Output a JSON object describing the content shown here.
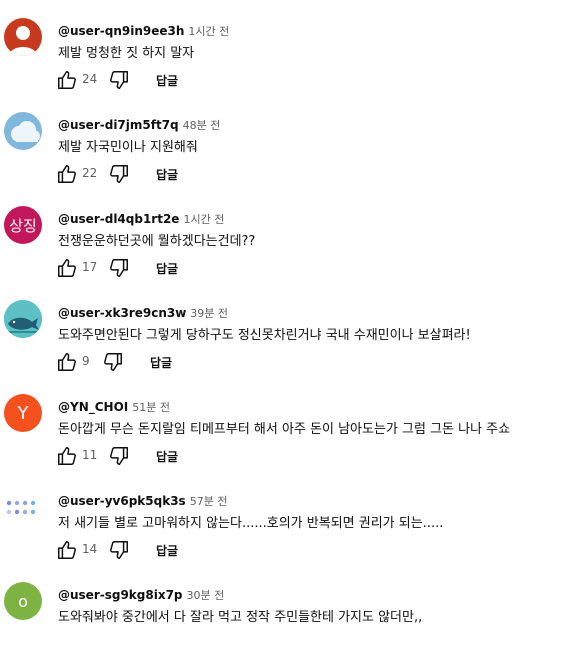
{
  "ui": {
    "reply_label": "답글"
  },
  "comments": [
    {
      "handle": "@user-qn9in9ee3h",
      "time": "1시간 전",
      "text": "제발 멍청한 짓 하지 말자",
      "likes": "24",
      "avatar": {
        "type": "person",
        "bg": "#c73a1e"
      }
    },
    {
      "handle": "@user-di7jm5ft7q",
      "time": "48분 전",
      "text": "제발 자국민이나 지원해줘",
      "likes": "22",
      "avatar": {
        "type": "cloud",
        "bg": "#7fb7dd"
      }
    },
    {
      "handle": "@user-dl4qb1rt2e",
      "time": "1시간 전",
      "text": "전쟁운운하던곳에 뭘하겠다는건데??",
      "likes": "17",
      "avatar": {
        "type": "text",
        "label": "상징",
        "bg": "#c2185b"
      }
    },
    {
      "handle": "@user-xk3re9cn3w",
      "time": "39분 전",
      "text": "도와주면안된다  그렇게 당하구도 정신못차린거냐 국내 수재민이나 보살펴라!",
      "likes": "9",
      "avatar": {
        "type": "whale",
        "bg": "#4fb3b0"
      }
    },
    {
      "handle": "@YN_CHOI",
      "time": "51분 전",
      "text": "돈아깝게 무슨 돈지랄임 티메프부터 해서 아주 돈이 남아도는가 그럼 그돈 나나 주쇼",
      "likes": "11",
      "avatar": {
        "type": "text",
        "label": "Y",
        "bg": "#f4511e"
      }
    },
    {
      "handle": "@user-yv6pk5qk3s",
      "time": "57분 전",
      "text": "저 새기들 별로 고마워하지 않는다......호의가 반복되면 권리가 되는.....",
      "likes": "14",
      "avatar": {
        "type": "dots",
        "bg": "#ffffff"
      }
    },
    {
      "handle": "@user-sg9kg8ix7p",
      "time": "30분 전",
      "text": "도와줘봐야 중간에서 다 잘라 먹고 정작 주민들한테 가지도 않더만,,",
      "likes": "",
      "avatar": {
        "type": "text",
        "label": "o",
        "bg": "#7cb342"
      }
    }
  ]
}
